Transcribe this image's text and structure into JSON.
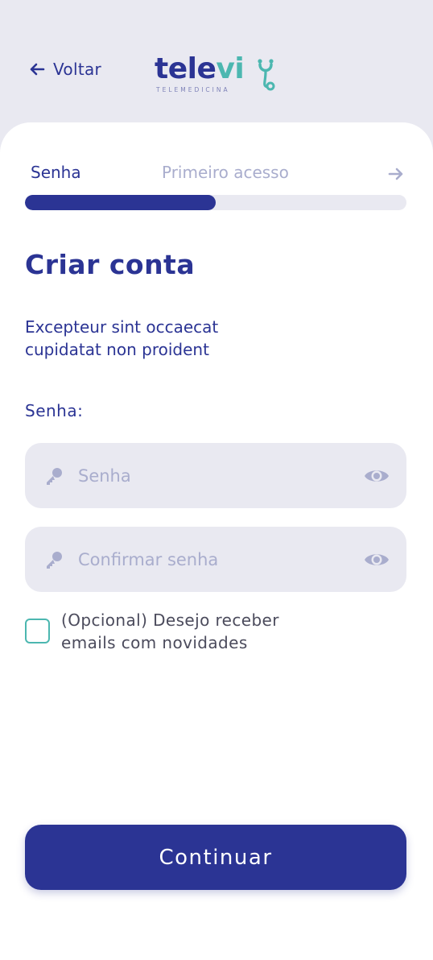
{
  "header": {
    "back_label": "Voltar",
    "logo": {
      "word_primary": "tele",
      "word_accent": "vi",
      "tagline": "TELEMEDICINA"
    }
  },
  "steps": {
    "current": "Senha",
    "next": "Primeiro acesso",
    "progress_fraction": 0.5
  },
  "form": {
    "title": "Criar conta",
    "subtitle": "Excepteur sint occaecat cupidatat non proident",
    "password_label": "Senha:",
    "password_placeholder": "Senha",
    "confirm_placeholder": "Confirmar senha",
    "newsletter_label": "(Opcional) Desejo receber emails com novidades",
    "newsletter_checked": false,
    "submit_label": "Continuar"
  },
  "icons": {
    "back": "arrow-left-icon",
    "next_step": "arrow-right-icon",
    "field": "key-icon",
    "visibility": "eye-icon"
  },
  "colors": {
    "primary": "#2b3494",
    "accent": "#4cb7b0",
    "muted": "#a9adcd",
    "surface": "#e9e9f1",
    "background": "#ffffff"
  }
}
